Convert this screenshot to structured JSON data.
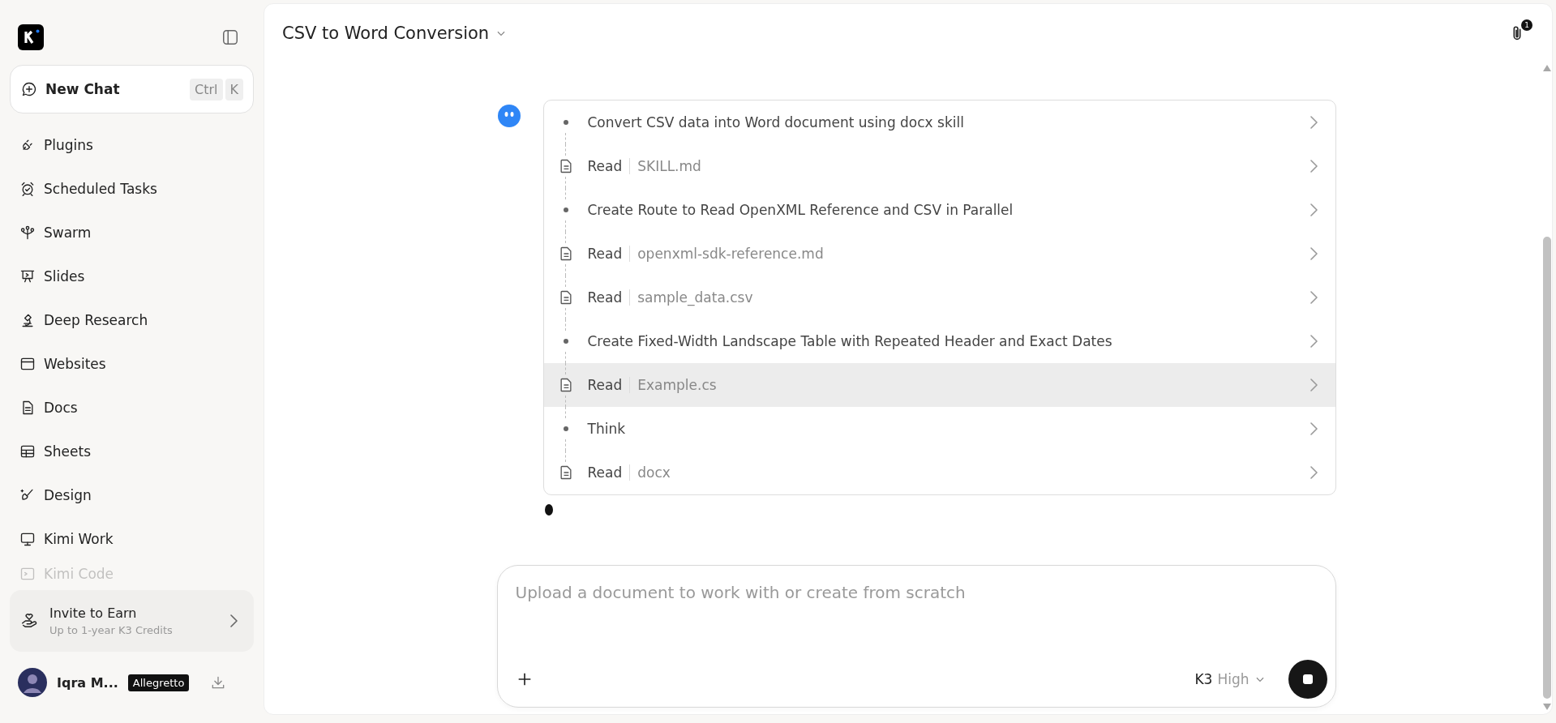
{
  "sidebar": {
    "new_chat": {
      "label": "New Chat",
      "shortcut": [
        "Ctrl",
        "K"
      ]
    },
    "items": [
      {
        "label": "Plugins",
        "faded": false
      },
      {
        "label": "Scheduled Tasks",
        "faded": false
      },
      {
        "label": "Swarm",
        "faded": false
      },
      {
        "label": "Slides",
        "faded": false
      },
      {
        "label": "Deep Research",
        "faded": false
      },
      {
        "label": "Websites",
        "faded": false
      },
      {
        "label": "Docs",
        "faded": false
      },
      {
        "label": "Sheets",
        "faded": false
      },
      {
        "label": "Design",
        "faded": false
      },
      {
        "label": "Kimi Work",
        "faded": false
      },
      {
        "label": "Kimi Code",
        "faded": true
      }
    ],
    "invite": {
      "title": "Invite to Earn",
      "subtitle": "Up to 1-year K3 Credits"
    },
    "user": {
      "name": "Iqra M...",
      "plan": "Allegretto"
    }
  },
  "header": {
    "title": "CSV to Word Conversion",
    "attachments_badge": "1"
  },
  "steps": [
    {
      "kind": "task",
      "text": "Convert CSV data into Word document using docx skill",
      "highlighted": false
    },
    {
      "kind": "read",
      "action": "Read",
      "file": "SKILL.md",
      "highlighted": false
    },
    {
      "kind": "task",
      "text": "Create Route to Read OpenXML Reference and CSV in Parallel",
      "highlighted": false
    },
    {
      "kind": "read",
      "action": "Read",
      "file": "openxml-sdk-reference.md",
      "highlighted": false
    },
    {
      "kind": "read",
      "action": "Read",
      "file": "sample_data.csv",
      "highlighted": false
    },
    {
      "kind": "task",
      "text": "Create Fixed-Width Landscape Table with Repeated Header and Exact Dates",
      "highlighted": false
    },
    {
      "kind": "read",
      "action": "Read",
      "file": "Example.cs",
      "highlighted": true
    },
    {
      "kind": "task",
      "text": "Think",
      "highlighted": false
    },
    {
      "kind": "read",
      "action": "Read",
      "file": "docx",
      "highlighted": false
    }
  ],
  "composer": {
    "placeholder": "Upload a document to work with or create from scratch",
    "model": "K3",
    "effort": "High"
  }
}
